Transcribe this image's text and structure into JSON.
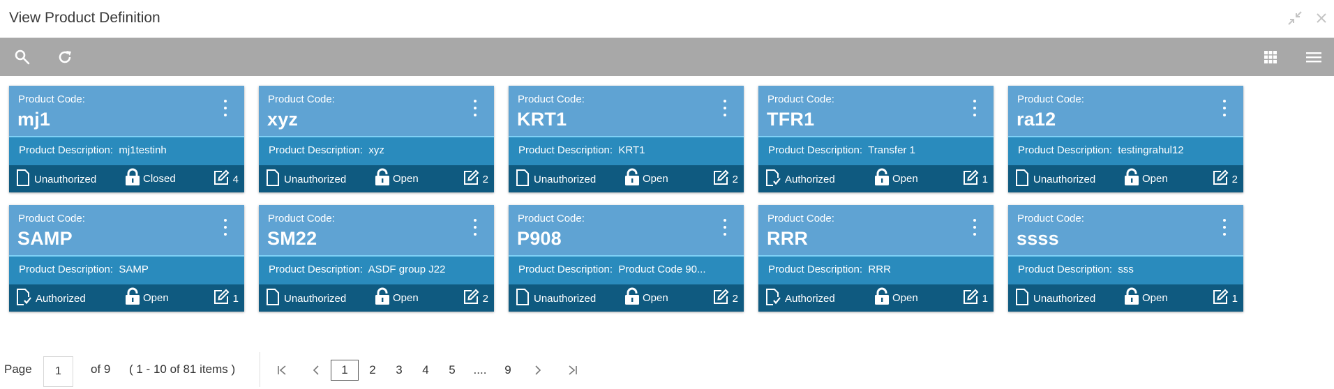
{
  "window": {
    "title": "View Product Definition",
    "minimize_icon": "collapse-icon",
    "close_icon": "close-icon"
  },
  "toolbar": {
    "search_icon": "search-icon",
    "refresh_icon": "refresh-icon",
    "grid_icon": "grid-view-icon",
    "list_icon": "list-view-icon"
  },
  "colors": {
    "card_top": "#5fa3d3",
    "card_mid": "#2a8bbd",
    "card_bottom": "#0f5a80",
    "toolbar": "#a8a8a8"
  },
  "card_labels": {
    "code_label": "Product Code:",
    "desc_label": "Product Description:"
  },
  "cards": [
    {
      "code": "mj1",
      "description": "mj1testinh",
      "status": "Unauthorized",
      "lock": "Closed",
      "count": "4"
    },
    {
      "code": "xyz",
      "description": "xyz",
      "status": "Unauthorized",
      "lock": "Open",
      "count": "2"
    },
    {
      "code": "KRT1",
      "description": "KRT1",
      "status": "Unauthorized",
      "lock": "Open",
      "count": "2"
    },
    {
      "code": "TFR1",
      "description": "Transfer 1",
      "status": "Authorized",
      "lock": "Open",
      "count": "1"
    },
    {
      "code": "ra12",
      "description": "testingrahul12",
      "status": "Unauthorized",
      "lock": "Open",
      "count": "2"
    },
    {
      "code": "SAMP",
      "description": "SAMP",
      "status": "Authorized",
      "lock": "Open",
      "count": "1"
    },
    {
      "code": "SM22",
      "description": "ASDF group J22",
      "status": "Unauthorized",
      "lock": "Open",
      "count": "2"
    },
    {
      "code": "P908",
      "description": "Product Code 90...",
      "status": "Unauthorized",
      "lock": "Open",
      "count": "2"
    },
    {
      "code": "RRR",
      "description": "RRR",
      "status": "Authorized",
      "lock": "Open",
      "count": "1"
    },
    {
      "code": "ssss",
      "description": "sss",
      "status": "Unauthorized",
      "lock": "Open",
      "count": "1"
    }
  ],
  "pagination": {
    "page_label": "Page",
    "current_page": "1",
    "of_label": "of 9",
    "items_label": "( 1 - 10 of 81 items )",
    "pages": [
      "1",
      "2",
      "3",
      "4",
      "5",
      "....",
      "9"
    ]
  }
}
